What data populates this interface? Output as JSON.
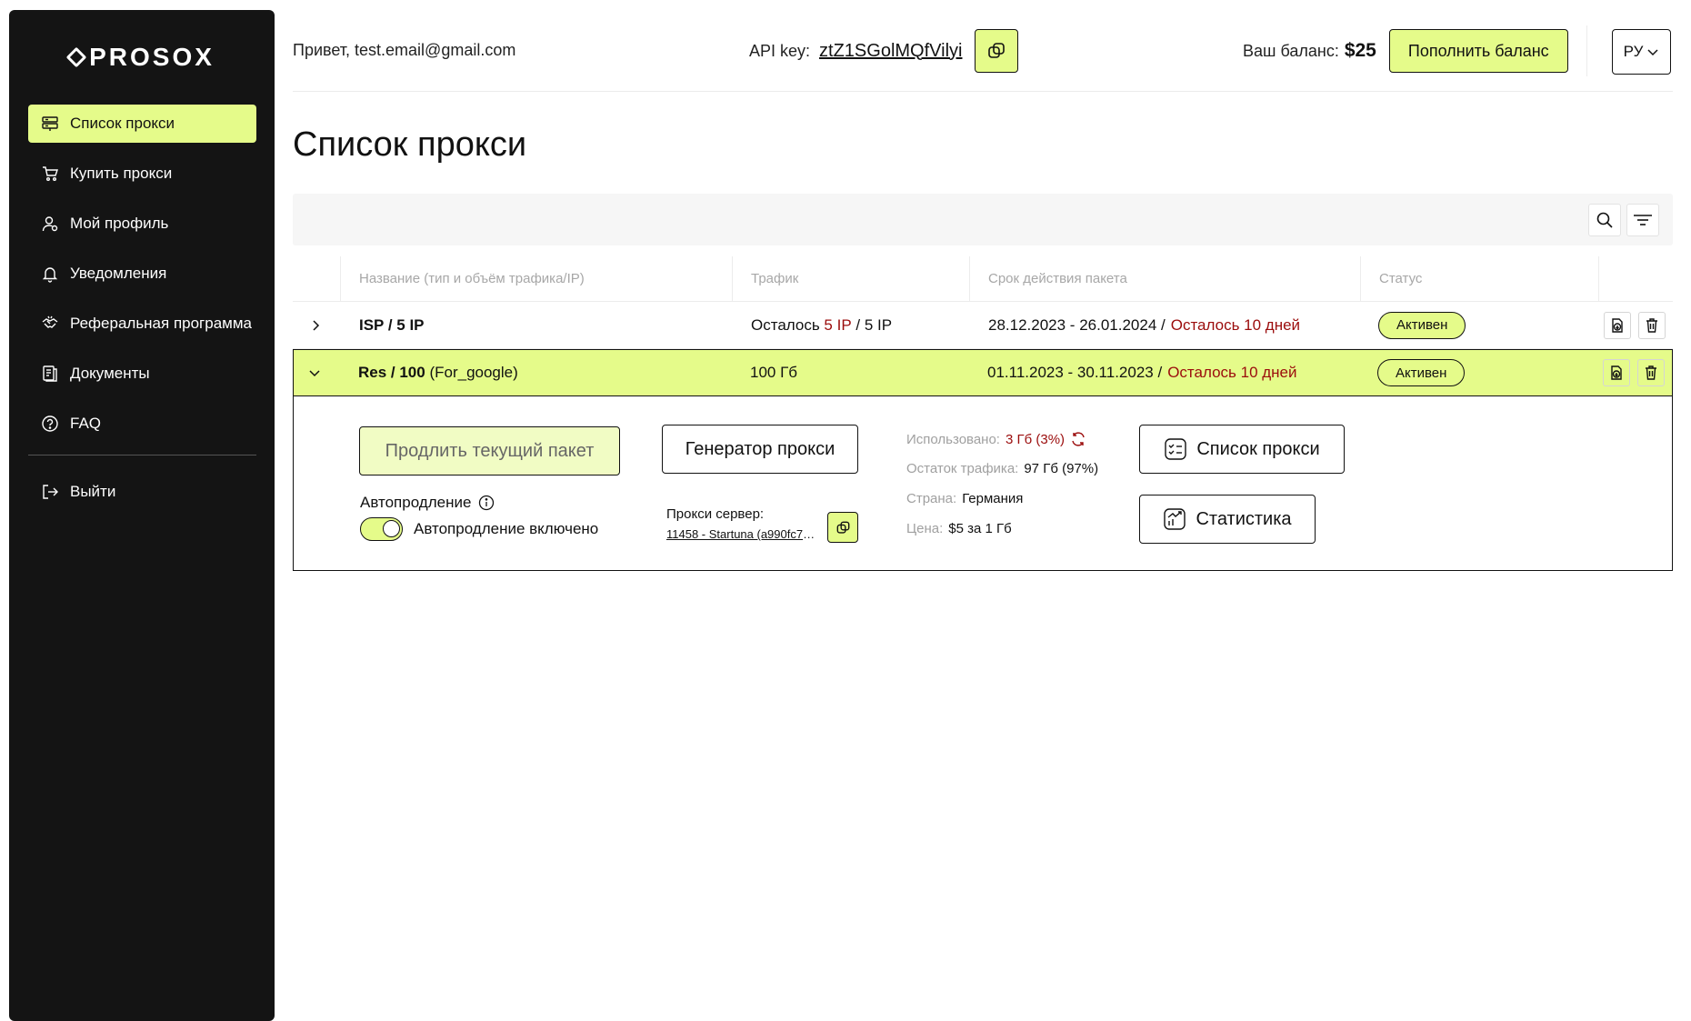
{
  "brand": {
    "name": "PROSOX"
  },
  "colors": {
    "accent": "#e5fb8a",
    "sidebar_bg": "#141414",
    "warning": "#9b0c0c"
  },
  "sidebar": {
    "items": [
      {
        "label": "Список прокси",
        "icon": "server-icon",
        "active": true
      },
      {
        "label": "Купить прокси",
        "icon": "cart-icon",
        "active": false
      },
      {
        "label": "Мой профиль",
        "icon": "user-icon",
        "active": false
      },
      {
        "label": "Уведомления",
        "icon": "bell-icon",
        "active": false
      },
      {
        "label": "Реферальная программа",
        "icon": "handshake-icon",
        "active": false
      },
      {
        "label": "Документы",
        "icon": "document-icon",
        "active": false
      },
      {
        "label": "FAQ",
        "icon": "question-icon",
        "active": false
      }
    ],
    "logout": {
      "label": "Выйти",
      "icon": "logout-icon"
    }
  },
  "header": {
    "greeting": "Привет, test.email@gmail.com",
    "api_label": "API key:",
    "api_key": "ztZ1SGolMQfVilyi",
    "balance_label": "Ваш баланс:",
    "balance_value": "$25",
    "topup_label": "Пополнить баланс",
    "language": "РУ"
  },
  "page": {
    "title": "Список прокси"
  },
  "table": {
    "columns": [
      "Название (тип и объём трафика/IP)",
      "Трафик",
      "Срок действия пакета",
      "Статус"
    ],
    "rows": [
      {
        "name": "ISP / 5 IP",
        "name_suffix": "",
        "traffic_prefix": "Осталось ",
        "traffic_highlight": "5 IP",
        "traffic_suffix": " / 5 IP",
        "period": "28.12.2023 - 26.01.2024 /",
        "remaining": "Осталось 10 дней",
        "status": "Активен",
        "expanded": false
      },
      {
        "name": "Res / 100",
        "name_suffix": " (For_google)",
        "traffic": "100 Гб",
        "period": "01.11.2023 - 30.11.2023 /",
        "remaining": "Осталось 10 дней",
        "status": "Активен",
        "expanded": true
      }
    ]
  },
  "details": {
    "extend_label": "Продлить текущий пакет",
    "autorenew_label": "Автопродление",
    "autorenew_state_label": "Автопродление включено",
    "autorenew_enabled": true,
    "generator_label": "Генератор прокси",
    "server_label": "Прокси сервер:",
    "server_value": "11458 - Startuna (a990fc7b...",
    "used_label": "Использовано:",
    "used_value": "3 Гб (3%)",
    "remaining_label": "Остаток трафика:",
    "remaining_value": "97 Гб (97%)",
    "country_label": "Страна:",
    "country_value": "Германия",
    "price_label": "Цена:",
    "price_value": "$5 за 1 Гб",
    "proxy_list_label": "Список прокси",
    "stats_label": "Статистика"
  }
}
